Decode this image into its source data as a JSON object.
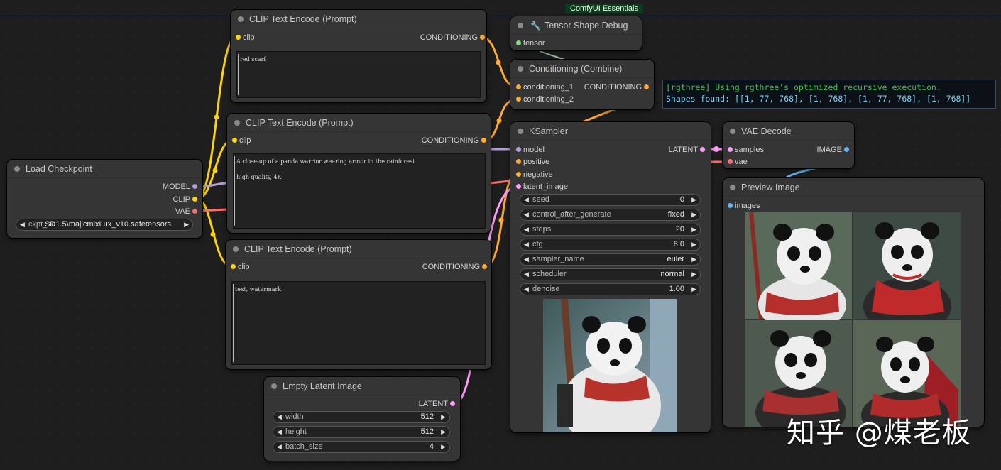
{
  "banner": "ComfyUI Essentials",
  "colors": {
    "clip": "#ffd500",
    "conditioning": "#ffa931",
    "model": "#b39ddb",
    "vae": "#ff6e6e",
    "latent": "#ff9cf9",
    "image": "#64b5f6",
    "tensor": "#79e07a"
  },
  "nodes": {
    "clip_top": {
      "title": "CLIP Text Encode (Prompt)",
      "input": "clip",
      "output": "CONDITIONING",
      "text": "red scarf"
    },
    "clip_mid": {
      "title": "CLIP Text Encode (Prompt)",
      "input": "clip",
      "output": "CONDITIONING",
      "text": "A close-up of a panda warrior wearing armor in the rainforest\n\nhigh quality, 4K"
    },
    "clip_bot": {
      "title": "CLIP Text Encode (Prompt)",
      "input": "clip",
      "output": "CONDITIONING",
      "text": "text, watermark"
    },
    "load_checkpoint": {
      "title": "Load Checkpoint",
      "outputs": [
        "MODEL",
        "CLIP",
        "VAE"
      ],
      "widget_name": "ckpt_na",
      "widget_value": "SD1.5\\majicmixLux_v10.safetensors"
    },
    "tensor_debug": {
      "title": "Tensor Shape Debug",
      "input": "tensor"
    },
    "cond_combine": {
      "title": "Conditioning (Combine)",
      "inputs": [
        "conditioning_1",
        "conditioning_2"
      ],
      "output": "CONDITIONING"
    },
    "ksampler": {
      "title": "KSampler",
      "inputs": [
        "model",
        "positive",
        "negative",
        "latent_image"
      ],
      "output": "LATENT",
      "widgets": [
        {
          "name": "seed",
          "value": "0"
        },
        {
          "name": "control_after_generate",
          "value": "fixed"
        },
        {
          "name": "steps",
          "value": "20"
        },
        {
          "name": "cfg",
          "value": "8.0"
        },
        {
          "name": "sampler_name",
          "value": "euler"
        },
        {
          "name": "scheduler",
          "value": "normal"
        },
        {
          "name": "denoise",
          "value": "1.00"
        }
      ]
    },
    "vae_decode": {
      "title": "VAE Decode",
      "inputs": [
        "samples",
        "vae"
      ],
      "output": "IMAGE"
    },
    "preview": {
      "title": "Preview Image",
      "input": "images"
    },
    "empty_latent": {
      "title": "Empty Latent Image",
      "output": "LATENT",
      "widgets": [
        {
          "name": "width",
          "value": "512"
        },
        {
          "name": "height",
          "value": "512"
        },
        {
          "name": "batch_size",
          "value": "4"
        }
      ]
    }
  },
  "console": {
    "line1": "[rgthree] Using rgthree's optimized recursive execution.",
    "line2": "Shapes found: [[1, 77, 768], [1, 768], [1, 77, 768], [1, 768]]"
  },
  "watermark": "知乎 @煤老板"
}
